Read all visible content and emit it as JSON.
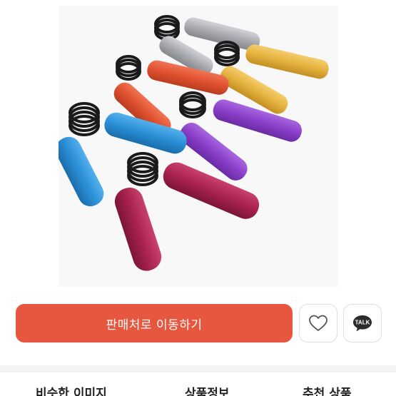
{
  "product": {
    "image_alt": "hand grippers",
    "zoom_icon": "plus-icon"
  },
  "actions": {
    "buy_label": "판매처로 이동하기",
    "wish_icon": "heart-outline-icon",
    "talk_icon": "kakaotalk-icon",
    "talk_label": "TALK"
  },
  "tabs": [
    {
      "label": "비슷한 이미지"
    },
    {
      "label": "상품정보"
    },
    {
      "label": "추천 상품"
    }
  ],
  "colors": {
    "buy_button": "#e7573f",
    "gripper_silver": "#a9abb0",
    "gripper_gold": "#e4b23f",
    "gripper_orange": "#e0512f",
    "gripper_purple": "#8a3fc9",
    "gripper_blue": "#2a8fd6",
    "gripper_crimson": "#a8234d",
    "spring": "#1a1a1a"
  }
}
